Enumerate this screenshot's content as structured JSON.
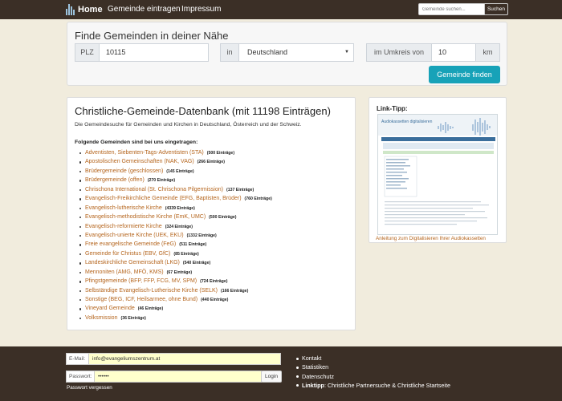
{
  "nav": {
    "brand": "Home",
    "links": [
      "Gemeinde eintragen",
      "Impressum"
    ],
    "search_placeholder": "Gemeinde suchen...",
    "search_button": "Suchen"
  },
  "search": {
    "title": "Finde Gemeinden in deiner Nähe",
    "plz_label": "PLZ",
    "plz_value": "10115",
    "in_label": "in",
    "country": "Deutschland",
    "radius_label": "im Umkreis von",
    "radius_value": "10",
    "unit": "km",
    "submit": "Gemeinde finden"
  },
  "main": {
    "title": "Christliche-Gemeinde-Datenbank (mit 11198 Einträgen)",
    "description": "Die Gemeindesuche für Gemeinden und Kirchen in Deutschland, Österreich und der Schweiz.",
    "list_heading": "Folgende Gemeinden sind bei uns eingetragen:",
    "denominations": [
      {
        "name": "Adventisten, Siebenten-Tags-Adventisten (STA)",
        "count": "(500 Einträge)"
      },
      {
        "name": "Apostolischen Gemeinschaften (NAK, VAG)",
        "count": "(266 Einträge)"
      },
      {
        "name": "Brüdergemeinde (geschlossen)",
        "count": "(145 Einträge)"
      },
      {
        "name": "Brüdergemeinde (offen)",
        "count": "(270 Einträge)"
      },
      {
        "name": "Chrischona International (St. Chrischona Pilgermission)",
        "count": "(137 Einträge)"
      },
      {
        "name": "Evangelisch-Freikirchliche Gemeinde (EFG, Baptisten, Brüder)",
        "count": "(760 Einträge)"
      },
      {
        "name": "Evangelisch-lutherische Kirche",
        "count": "(4339 Einträge)"
      },
      {
        "name": "Evangelisch-methodistische Kirche (EmK, UMC)",
        "count": "(500 Einträge)"
      },
      {
        "name": "Evangelisch-reformierte Kirche",
        "count": "(324 Einträge)"
      },
      {
        "name": "Evangelisch-unierte Kirche (UEK, EKU)",
        "count": "(1332 Einträge)"
      },
      {
        "name": "Freie evangelische Gemeinde (FeG)",
        "count": "(511 Einträge)"
      },
      {
        "name": "Gemeinde für Christus (EBV, GfC)",
        "count": "(85 Einträge)"
      },
      {
        "name": "Landeskirchliche Gemeinschaft (LKG)",
        "count": "(540 Einträge)"
      },
      {
        "name": "Mennoniten (AMG, MFÖ, KMS)",
        "count": "(67 Einträge)"
      },
      {
        "name": "Pfingstgemeinde (BFP, FFP, FCG, MV, SPM)",
        "count": "(724 Einträge)"
      },
      {
        "name": "Selbständige Evangelisch-Lutherische Kirche (SELK)",
        "count": "(166 Einträge)"
      },
      {
        "name": "Sonstige (BEG, ICF, Heilsarmee, ohne Bund)",
        "count": "(440 Einträge)"
      },
      {
        "name": "Vineyard Gemeinde",
        "count": "(46 Einträge)"
      },
      {
        "name": "Volksmission",
        "count": "(36 Einträge)"
      }
    ]
  },
  "tip": {
    "title": "Link-Tipp:",
    "image_heading": "Audiokassetten digitalisieren",
    "caption": "Anleitung zum Digitalisieren Ihrer Audiokassetten"
  },
  "footer": {
    "email_label": "E-Mail:",
    "email_value": "info@evangeliumszentrum.at",
    "password_label": "Passwort:",
    "password_value": "••••••",
    "login_button": "Login",
    "forgot_link": "Passwort vergessen",
    "links": [
      "Kontakt",
      "Statistiken",
      "Datenschutz"
    ],
    "linktipp_label": "Linktipp",
    "linktipp_text": ": Christliche Partnersuche & Christliche Startseite"
  },
  "colors": {
    "nav_bg": "#3b2f26",
    "page_bg": "#f1ecdd",
    "accent": "#17a2b8",
    "link": "#b5651d"
  }
}
